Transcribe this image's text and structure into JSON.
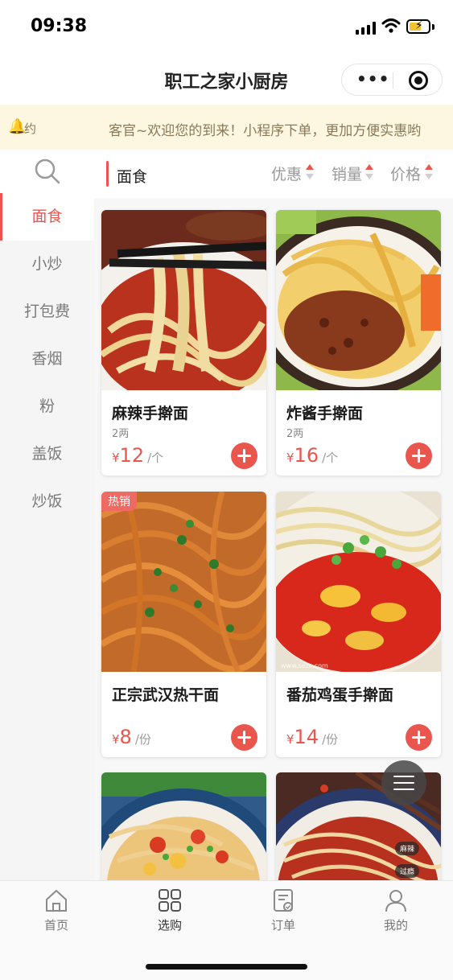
{
  "status_bar": {
    "time": "09:38"
  },
  "header": {
    "title": "职工之家小厨房"
  },
  "notice": {
    "prefix": "约",
    "text": "客官~欢迎您的到来！小程序下单，更加方便实惠哟"
  },
  "sidebar": {
    "categories": [
      "面食",
      "小炒",
      "打包费",
      "香烟",
      "粉",
      "盖饭",
      "炒饭"
    ],
    "active_index": 0
  },
  "content": {
    "section_title": "面食",
    "sort_options": [
      "优惠",
      "销量",
      "价格"
    ]
  },
  "products": [
    {
      "name": "麻辣手擀面",
      "spec": "2两",
      "currency": "¥",
      "price": "12",
      "unit": "/个"
    },
    {
      "name": "炸酱手擀面",
      "spec": "2两",
      "currency": "¥",
      "price": "16",
      "unit": "/个"
    },
    {
      "name": "正宗武汉热干面",
      "spec": "",
      "currency": "¥",
      "price": "8",
      "unit": "/份",
      "tag": "热销"
    },
    {
      "name": "番茄鸡蛋手擀面",
      "spec": "",
      "currency": "¥",
      "price": "14",
      "unit": "/份",
      "watermark": "www.sezc.com"
    },
    {
      "name": "",
      "spec": "",
      "currency": "",
      "price": "",
      "unit": ""
    },
    {
      "name": "",
      "spec": "",
      "currency": "",
      "price": "",
      "unit": "",
      "badges": [
        "麻辣",
        "过瘾"
      ]
    }
  ],
  "tab_bar": {
    "items": [
      {
        "label": "首页",
        "icon": "home-icon"
      },
      {
        "label": "选购",
        "icon": "grid-icon"
      },
      {
        "label": "订单",
        "icon": "order-icon"
      },
      {
        "label": "我的",
        "icon": "user-icon"
      }
    ],
    "active_index": 1
  },
  "colors": {
    "accent": "#e8564e",
    "notice_bg": "#fdf6e1",
    "sidebar_bg": "#f5f5f5"
  }
}
